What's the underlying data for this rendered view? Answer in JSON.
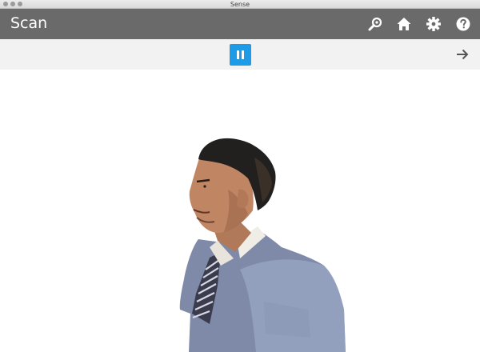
{
  "window": {
    "title": "Sense"
  },
  "appbar": {
    "title": "Scan",
    "icons": [
      "zoom-icon",
      "home-icon",
      "gear-icon",
      "help-icon"
    ]
  },
  "toolbar": {
    "pause_icon": "pause-icon",
    "next_icon": "arrow-right-icon",
    "accent_color": "#1e9be6"
  },
  "viewport": {
    "content": "3d-scan-preview-person"
  }
}
